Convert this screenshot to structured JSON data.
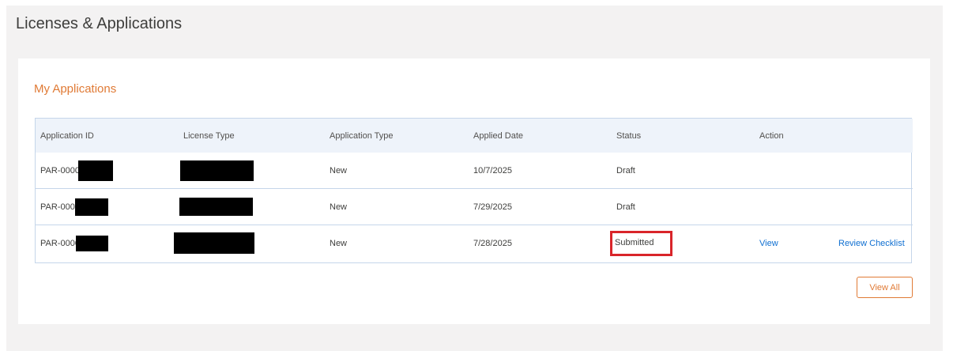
{
  "page": {
    "title": "Licenses & Applications"
  },
  "card": {
    "title": "My Applications",
    "view_all_label": "View All"
  },
  "table": {
    "columns": [
      "Application ID",
      "License Type",
      "Application Type",
      "Applied Date",
      "Status",
      "Action"
    ],
    "rows": [
      {
        "id_prefix": "PAR-0000",
        "application_type": "New",
        "applied_date": "10/7/2025",
        "status": "Draft",
        "action_view": "",
        "action_checklist": ""
      },
      {
        "id_prefix": "PAR-0000",
        "application_type": "New",
        "applied_date": "7/29/2025",
        "status": "Draft",
        "action_view": "",
        "action_checklist": ""
      },
      {
        "id_prefix": "PAR-0000",
        "application_type": "New",
        "applied_date": "7/28/2025",
        "status": "Submitted",
        "action_view": "View",
        "action_checklist": "Review Checklist"
      }
    ]
  },
  "colors": {
    "accent": "#e07a35",
    "link": "#0f6fd1",
    "highlight": "#d9252a",
    "header_bg": "#eef3fa",
    "border": "#c5d6ea"
  }
}
